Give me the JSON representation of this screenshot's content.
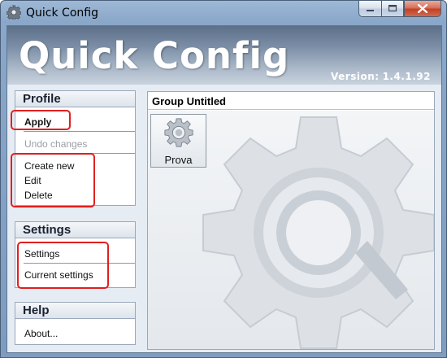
{
  "window": {
    "title": "Quick Config",
    "icon": "gear-icon",
    "controls": [
      "minimize-icon",
      "maximize-icon",
      "close-icon"
    ]
  },
  "banner": {
    "title": "Quick Config",
    "version_label": "Version:",
    "version": "1.4.1.92"
  },
  "profile": {
    "header": "Profile",
    "apply": "Apply",
    "undo": "Undo changes",
    "create_new": "Create new",
    "edit": "Edit",
    "delete": "Delete"
  },
  "settings": {
    "header": "Settings",
    "settings": "Settings",
    "current_settings": "Current settings"
  },
  "help": {
    "header": "Help",
    "about": "About..."
  },
  "group": {
    "title": "Group Untitled",
    "items": [
      {
        "label": "Prova",
        "icon": "gear-icon"
      }
    ]
  },
  "colors": {
    "highlight": "#e0201f",
    "banner_text": "#ffffff"
  }
}
